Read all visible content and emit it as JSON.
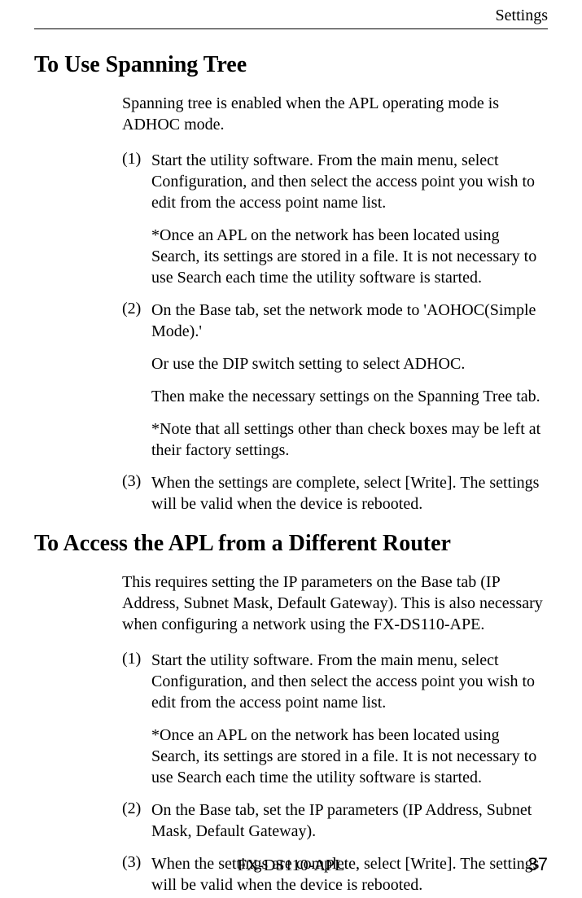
{
  "header": {
    "label": "Settings"
  },
  "sections": [
    {
      "heading": "To Use Spanning Tree",
      "intro": "Spanning tree is enabled when the APL operating mode is ADHOC mode.",
      "items": [
        {
          "num": "(1)",
          "paras": [
            "Start the utility software.   From the main menu, select Configuration, and then select the access point you wish to edit from the access point name list.",
            "*Once an APL on the network has been located using Search, its settings are stored in a file.   It is not necessary to use Search each time the utility software is started."
          ]
        },
        {
          "num": "(2)",
          "paras": [
            "On the Base tab, set the network mode to 'AOHOC(Simple Mode).'",
            "Or use the DIP switch setting to select ADHOC.",
            "Then make the necessary settings on the Spanning Tree tab.",
            "*Note that all settings other than check boxes may be left at their factory settings."
          ]
        },
        {
          "num": "(3)",
          "paras": [
            "When the settings are complete, select [Write].   The settings will be valid when the device is rebooted."
          ]
        }
      ]
    },
    {
      "heading": "To Access the APL from a Different Router",
      "intro": "This requires setting the IP parameters on the Base tab (IP Address, Subnet Mask, Default Gateway).   This is also necessary when configuring a network using the FX-DS110-APE.",
      "items": [
        {
          "num": "(1)",
          "paras": [
            "Start the utility software.   From the main menu, select Configuration, and then select the access point you wish to edit from the access point name list.",
            "*Once an APL on the network has been located using Search, its settings are stored in a file.   It is not necessary to use Search each time the utility software is started."
          ]
        },
        {
          "num": "(2)",
          "paras": [
            "On the Base tab, set the IP parameters (IP Address, Subnet Mask, Default Gateway)."
          ]
        },
        {
          "num": "(3)",
          "paras": [
            "When the settings are complete, select [Write].   The settings will be valid when the device is rebooted."
          ]
        }
      ]
    }
  ],
  "footer": {
    "model": "FX-DS110-APL",
    "page": "37"
  }
}
